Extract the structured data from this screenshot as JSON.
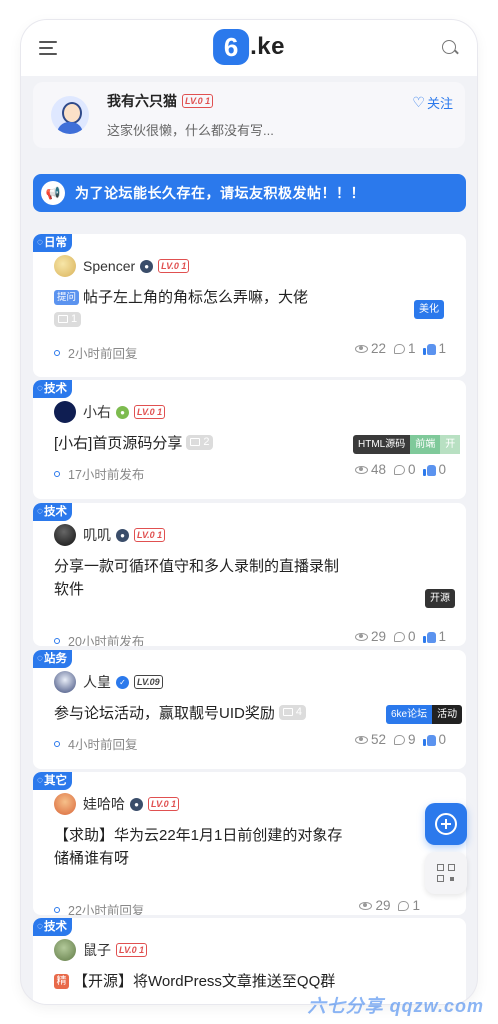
{
  "header": {
    "logo_mark": "6",
    "logo_text": ".ke"
  },
  "profile": {
    "name": "我有六只猫",
    "level": "LV.0 1",
    "bio": "这家伙很懒，什么都没有写...",
    "follow_label": "关注"
  },
  "notice": {
    "text": "为了论坛能长久存在，请坛友积极发帖！！！"
  },
  "posts": [
    {
      "category": "日常",
      "author": "Spencer",
      "level": "LV.0 1",
      "prefix": "提问",
      "title": "帖子左上角的角标怎么弄嘛，大佬",
      "images": "1",
      "time": "2小时前回复",
      "views": "22",
      "comments": "1",
      "likes": "1",
      "tags": [
        "美化"
      ]
    },
    {
      "category": "技术",
      "author": "小右",
      "level": "LV.0 1",
      "title": "[小右]首页源码分享",
      "images": "2",
      "time": "17小时前发布",
      "views": "48",
      "comments": "0",
      "likes": "0",
      "tags": [
        "HTML源码",
        "前端",
        "开"
      ]
    },
    {
      "category": "技术",
      "author": "叽叽",
      "level": "LV.0 1",
      "title_line1": "分享一款可循环值守和多人录制的直播录制",
      "title_line2": "软件",
      "time": "20小时前发布",
      "views": "29",
      "comments": "0",
      "likes": "1",
      "tags": [
        "开源"
      ]
    },
    {
      "category": "站务",
      "author": "人皇",
      "level": "LV.09",
      "title": "参与论坛活动，赢取靓号UID奖励",
      "images": "4",
      "time": "4小时前回复",
      "views": "52",
      "comments": "9",
      "likes": "0",
      "tags": [
        "6ke论坛",
        "活动"
      ]
    },
    {
      "category": "其它",
      "author": "娃哈哈",
      "level": "LV.0 1",
      "title_line1": "【求助】华为云22年1月1日前创建的对象存",
      "title_line2": "储桶谁有呀",
      "time": "22小时前回复",
      "views": "29",
      "comments": "1",
      "likes": ""
    },
    {
      "category": "技术",
      "author": "鼠子",
      "level": "LV.0 1",
      "prefix": "精",
      "title": "【开源】将WordPress文章推送至QQ群"
    }
  ],
  "watermark": "六七分享 qqzw.com",
  "colors": {
    "accent": "#2b79ec",
    "level_red": "#e05050",
    "background": "#f1f2f6"
  }
}
